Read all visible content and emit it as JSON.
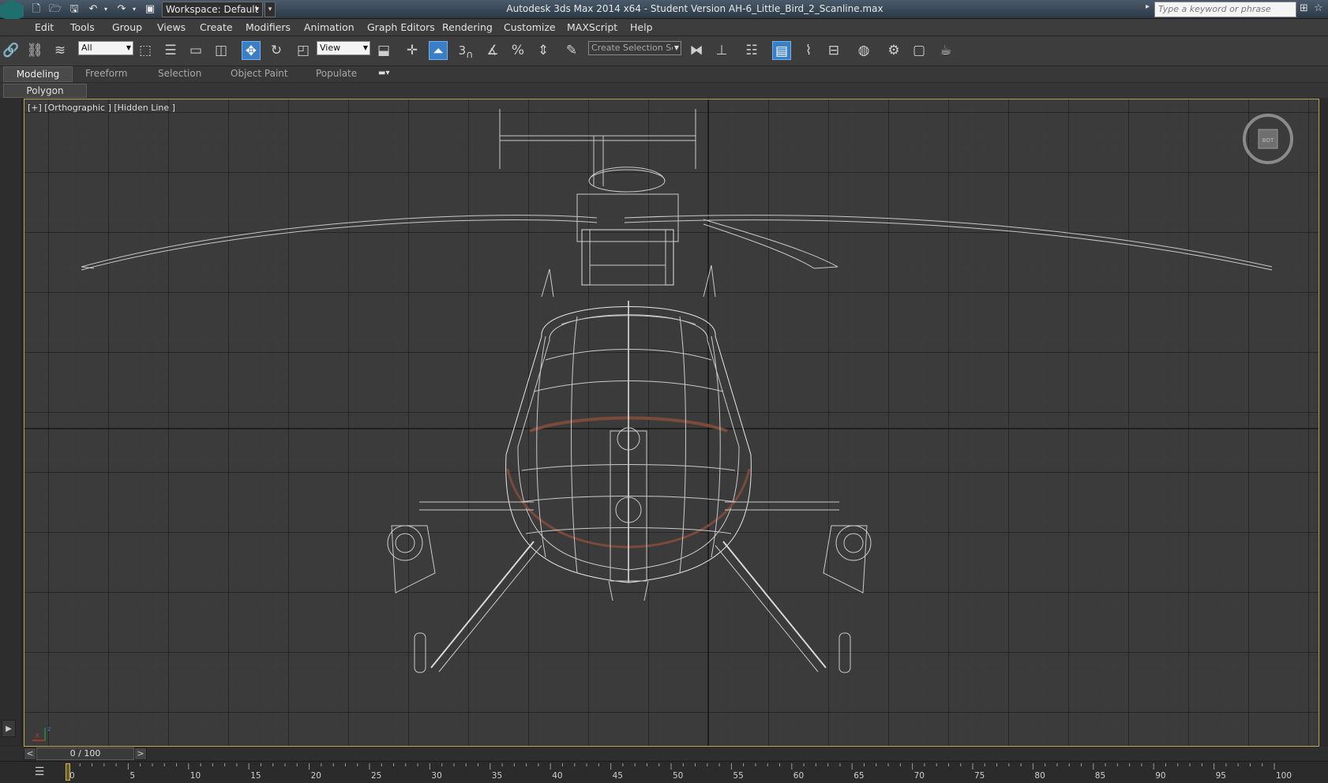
{
  "titlebar": {
    "workspace": "Workspace: Default",
    "window_title": "Autodesk 3ds Max  2014 x64   - Student Version    AH-6_Little_Bird_2_Scanline.max",
    "search_placeholder": "Type a keyword or phrase",
    "icons": [
      "app-logo",
      "new-file-icon",
      "open-icon",
      "save-icon",
      "undo-icon",
      "redo-icon",
      "project-folder-icon",
      "binoculars-icon",
      "favorites-icon"
    ]
  },
  "menu": [
    "Edit",
    "Tools",
    "Group",
    "Views",
    "Create",
    "Modifiers",
    "Animation",
    "Graph Editors",
    "Rendering",
    "Customize",
    "MAXScript",
    "Help"
  ],
  "toolbar": {
    "selection_filter": "All",
    "ref_coord": "View",
    "named_selection_placeholder": "Create Selection Se",
    "snap_label": "3"
  },
  "ribbon": {
    "tabs": [
      "Modeling",
      "Freeform",
      "Selection",
      "Object Paint",
      "Populate"
    ],
    "active_tab": "Modeling",
    "sub_panel": "Polygon Modeling"
  },
  "viewport": {
    "label": "[+] [Orthographic ] [Hidden Line ]",
    "viewcube_label": "BOT",
    "frame_color": "#b9a45a",
    "grid_color": "#3b3b3b"
  },
  "timeslider": {
    "frame": "0 / 100",
    "prev": "<",
    "next": ">"
  },
  "trackbar": {
    "ticks": [
      "0",
      "5",
      "10",
      "15",
      "20",
      "25",
      "30",
      "35",
      "40",
      "45",
      "50",
      "55",
      "60",
      "65",
      "70",
      "75",
      "80",
      "85",
      "90",
      "95",
      "100"
    ]
  }
}
